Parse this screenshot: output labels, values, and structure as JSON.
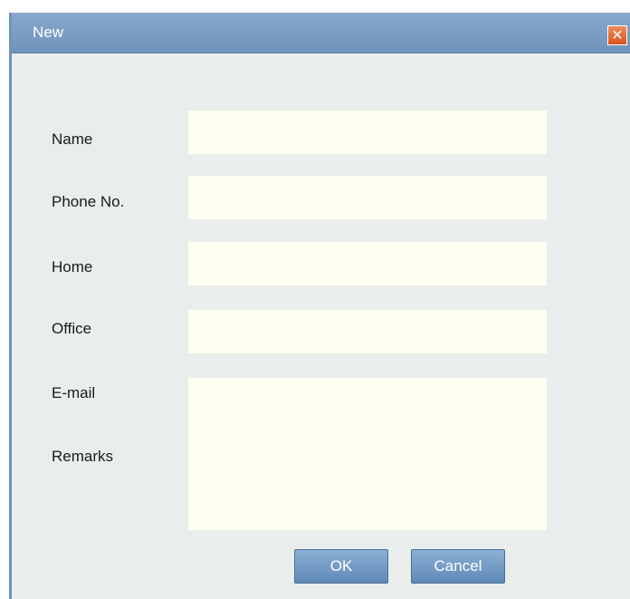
{
  "dialog": {
    "title": "New",
    "close_glyph": "✕"
  },
  "form": {
    "fields": [
      {
        "label": "Name",
        "value": "",
        "placeholder": ""
      },
      {
        "label": "Phone No.",
        "value": "",
        "placeholder": ""
      },
      {
        "label": "Home",
        "value": "",
        "placeholder": ""
      },
      {
        "label": "Office",
        "value": "",
        "placeholder": ""
      },
      {
        "label": "E-mail",
        "value": "",
        "placeholder": ""
      },
      {
        "label": "Remarks",
        "value": "",
        "placeholder": ""
      }
    ]
  },
  "buttons": {
    "ok_label": "OK",
    "cancel_label": "Cancel"
  },
  "icons": {
    "close": "close-icon"
  },
  "colors": {
    "titlebar": "#7b9dc4",
    "close_button": "#e0642f",
    "field_background": "#fffff2",
    "button": "#6f97c2"
  }
}
